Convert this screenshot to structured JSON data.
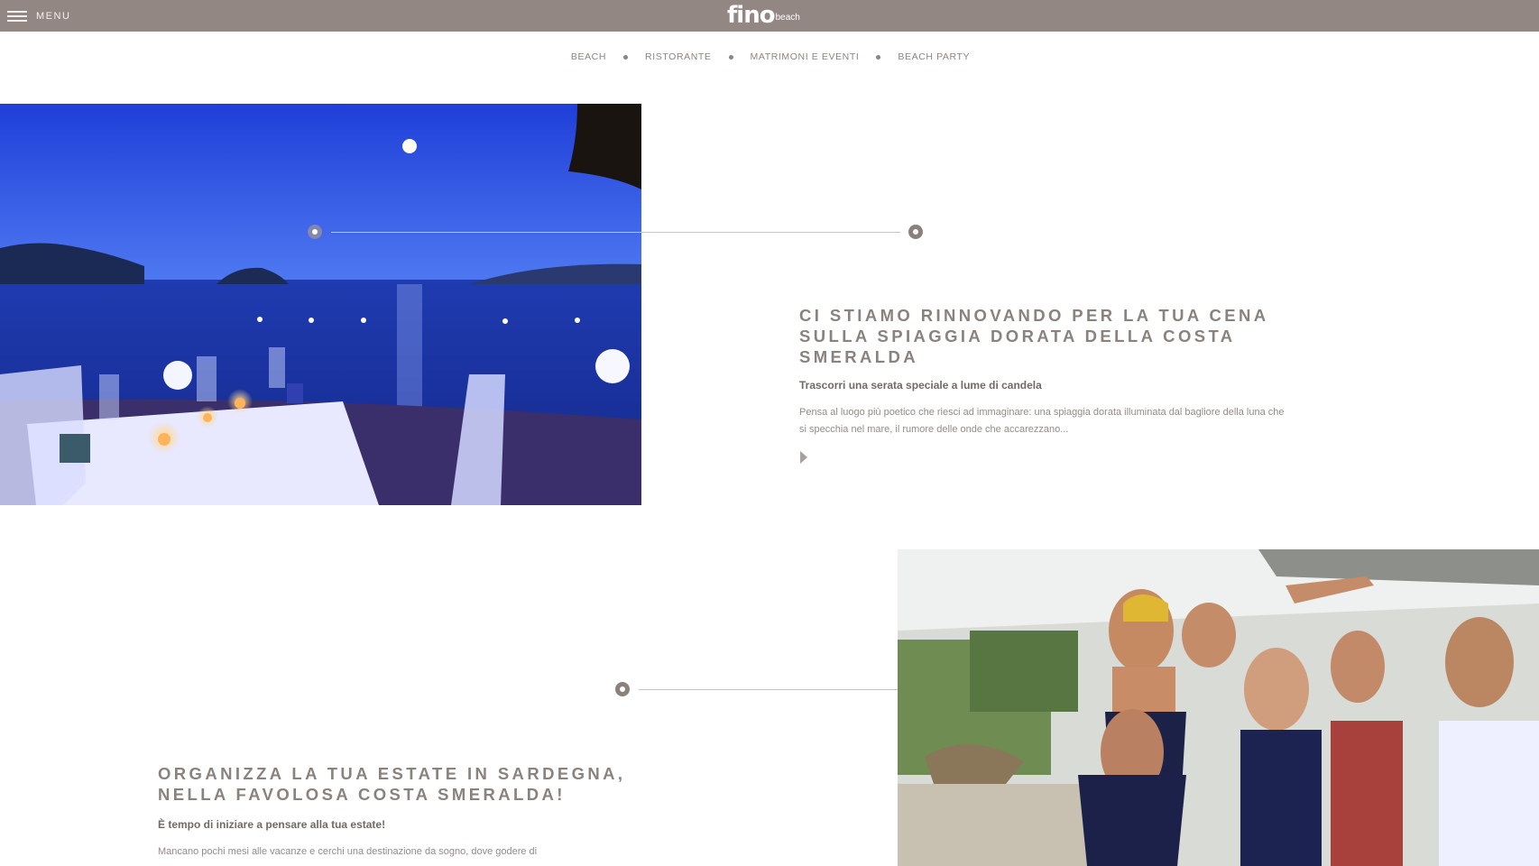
{
  "header": {
    "menu_label": "MENU",
    "logo_text": "fino",
    "logo_sub": "beach",
    "background_color": "#928782"
  },
  "subnav": {
    "items": [
      "BEACH",
      "RISTORANTE",
      "MATRIMONI E EVENTI",
      "BEACH PARTY"
    ]
  },
  "sections": [
    {
      "title": "CI STIAMO RINNOVANDO PER LA TUA CENA SULLA SPIAGGIA DORATA DELLA COSTA SMERALDA",
      "subtitle": "Trascorri una serata speciale a lume di candela",
      "body": "Pensa al luogo più poetico che riesci ad immaginare: una spiaggia dorata illuminata dal bagliore della luna che si specchia nel mare, il rumore delle onde che accarezzano...",
      "more_icon": "play-arrow-icon"
    },
    {
      "title": "ORGANIZZA LA TUA ESTATE IN SARDEGNA, NELLA FAVOLOSA COSTA SMERALDA!",
      "subtitle": "È tempo di iniziare a pensare alla tua estate!",
      "body": "Mancano pochi mesi alle vacanze e cerchi una destinazione da sogno, dove godere di"
    }
  ],
  "icons": [
    "hamburger-menu-icon",
    "timeline-node-icon",
    "play-arrow-icon"
  ]
}
